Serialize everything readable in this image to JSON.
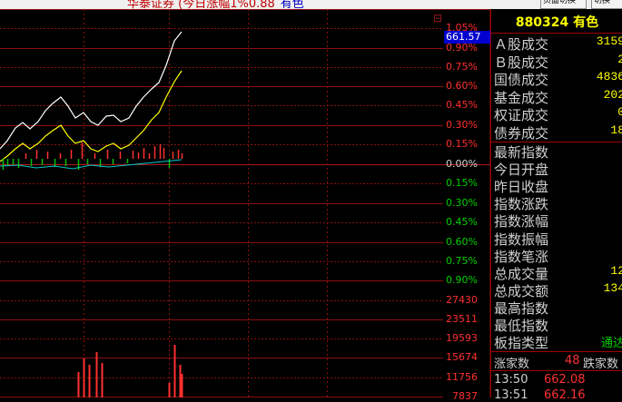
{
  "window": {
    "title": "华泰证券 (今日涨幅1%0.88",
    "title_suffix": "有色",
    "buttons": [
      "页面切换",
      "切换"
    ]
  },
  "chart": {
    "price_tag": "661.57",
    "tools_icon": "settings-icon",
    "right_axis": [
      "1.05%",
      "0.90%",
      "0.75%",
      "0.60%",
      "0.45%",
      "0.30%",
      "0.15%",
      "0.00%",
      "0.15%",
      "0.30%",
      "0.45%",
      "0.60%",
      "0.75%",
      "0.90%"
    ],
    "volume_axis": [
      "27430",
      "23511",
      "19593",
      "15674",
      "11756",
      "7837"
    ]
  },
  "chart_data": {
    "type": "line",
    "series": [
      {
        "values": [
          0.12,
          0.18,
          0.28,
          0.32,
          0.27,
          0.33,
          0.41,
          0.47,
          0.52,
          0.45,
          0.36,
          0.4,
          0.33,
          0.3,
          0.37,
          0.38,
          0.33,
          0.36,
          0.45,
          0.52,
          0.58,
          0.63,
          0.76,
          0.95,
          1.02
        ]
      },
      {
        "values": [
          0.02,
          0.06,
          0.12,
          0.16,
          0.12,
          0.16,
          0.22,
          0.26,
          0.3,
          0.22,
          0.16,
          0.18,
          0.12,
          0.1,
          0.14,
          0.16,
          0.12,
          0.15,
          0.2,
          0.26,
          0.34,
          0.4,
          0.52,
          0.64,
          0.72
        ]
      }
    ],
    "ylim": [
      -0.9,
      1.05
    ]
  },
  "panel": {
    "code": "880324 有色",
    "rows1": [
      {
        "label": "Ａ股成交",
        "value": "3159"
      },
      {
        "label": "Ｂ股成交",
        "value": "2"
      },
      {
        "label": "国债成交",
        "value": "4836"
      },
      {
        "label": "基金成交",
        "value": "202"
      },
      {
        "label": "权证成交",
        "value": "0"
      },
      {
        "label": "债券成交",
        "value": "18"
      }
    ],
    "rows2": [
      {
        "label": "最新指数",
        "value": ""
      },
      {
        "label": "今日开盘",
        "value": ""
      },
      {
        "label": "昨日收盘",
        "value": ""
      },
      {
        "label": "指数涨跌",
        "value": ""
      },
      {
        "label": "指数涨幅",
        "value": ""
      },
      {
        "label": "指数振幅",
        "value": ""
      },
      {
        "label": "指数笔涨",
        "value": ""
      },
      {
        "label": "总成交量",
        "value": "12"
      },
      {
        "label": "总成交额",
        "value": "134"
      },
      {
        "label": "最高指数",
        "value": ""
      },
      {
        "label": "最低指数",
        "value": ""
      },
      {
        "label": "板指类型",
        "value": "通达",
        "color": "green"
      }
    ],
    "breadth": {
      "up_label": "涨家数",
      "up_value": "48",
      "down_label": "跌家数"
    },
    "ticks": [
      {
        "time": "13:50",
        "price": "662.08"
      },
      {
        "time": "13:51",
        "price": "662.16"
      }
    ]
  }
}
